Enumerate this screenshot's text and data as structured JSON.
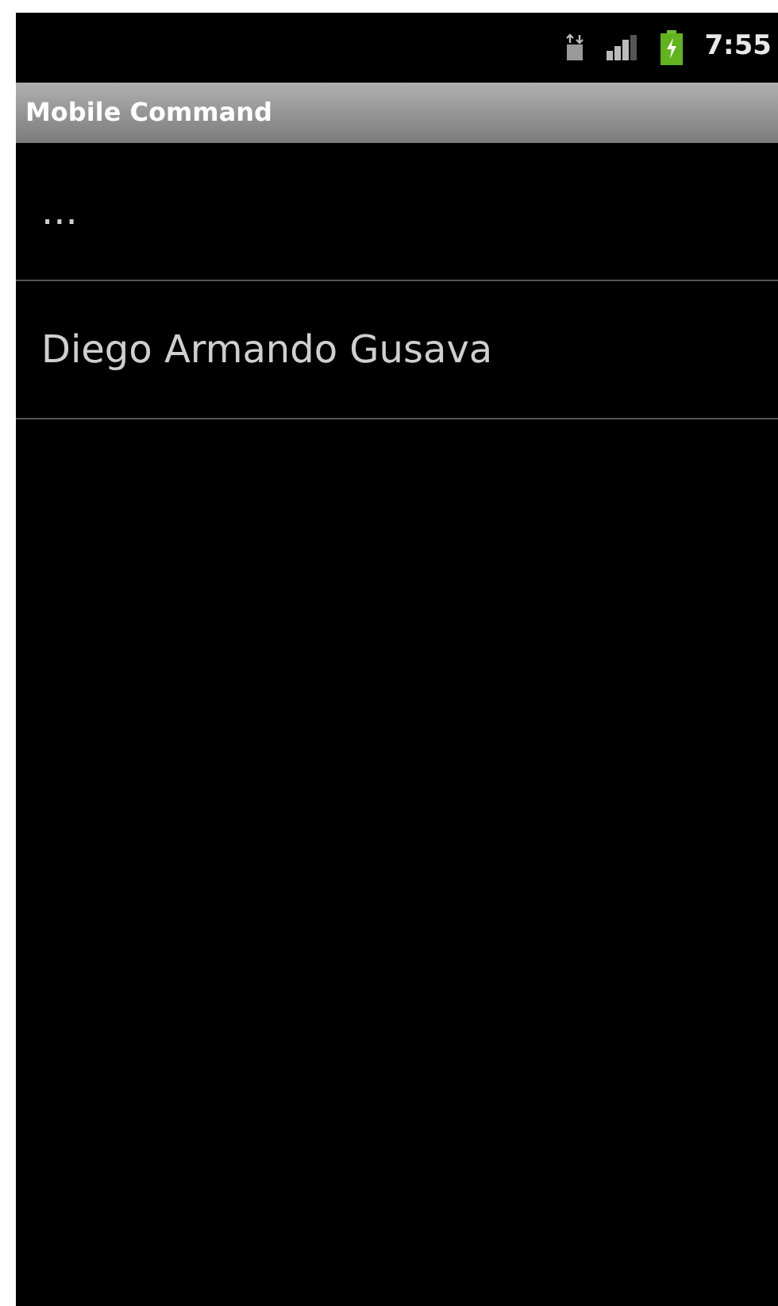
{
  "status_bar": {
    "time": "7:55"
  },
  "title_bar": {
    "title": "Mobile Command"
  },
  "list": {
    "items": [
      {
        "label": "..."
      },
      {
        "label": "Diego Armando Gusava"
      }
    ]
  }
}
